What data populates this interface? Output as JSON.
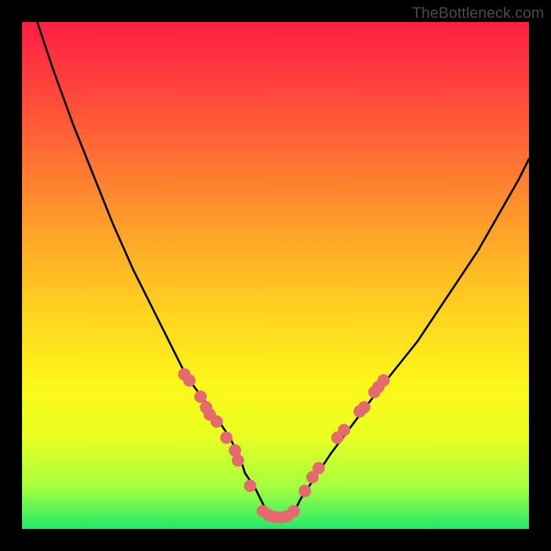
{
  "watermark": "TheBottleneck.com",
  "chart_data": {
    "type": "line",
    "title": "",
    "xlabel": "",
    "ylabel": "",
    "xlim": [
      0,
      100
    ],
    "ylim": [
      0,
      100
    ],
    "grid": false,
    "legend": false,
    "series": [
      {
        "name": "curve",
        "x": [
          3,
          6,
          10,
          14,
          18,
          22,
          26,
          30,
          32,
          34,
          37,
          39,
          41,
          43,
          44,
          46,
          47,
          48,
          49,
          50,
          51,
          52,
          53,
          54,
          55,
          57,
          59,
          61,
          64,
          67,
          70,
          74,
          78,
          82,
          86,
          90,
          94,
          98,
          100
        ],
        "y": [
          100,
          91,
          80,
          70,
          60,
          51,
          43,
          35,
          31,
          28,
          24,
          21,
          18,
          14,
          11,
          8,
          6,
          4,
          3,
          2,
          2,
          2,
          3,
          4,
          6,
          9,
          12,
          15,
          19,
          23,
          27,
          32,
          37,
          43,
          49,
          55,
          62,
          69,
          73
        ]
      }
    ],
    "markers": {
      "name": "dots",
      "color": "#e46a6f",
      "points": [
        {
          "x": 32.0,
          "y": 30.5
        },
        {
          "x": 33.0,
          "y": 29.3
        },
        {
          "x": 35.2,
          "y": 26.1
        },
        {
          "x": 36.3,
          "y": 24.0
        },
        {
          "x": 37.0,
          "y": 22.6
        },
        {
          "x": 38.4,
          "y": 21.2
        },
        {
          "x": 40.3,
          "y": 18.0
        },
        {
          "x": 42.0,
          "y": 15.5
        },
        {
          "x": 42.6,
          "y": 13.5
        },
        {
          "x": 45.0,
          "y": 8.5
        },
        {
          "x": 47.5,
          "y": 3.5
        },
        {
          "x": 48.7,
          "y": 2.7
        },
        {
          "x": 49.9,
          "y": 2.3
        },
        {
          "x": 51.1,
          "y": 2.3
        },
        {
          "x": 52.3,
          "y": 2.5
        },
        {
          "x": 53.6,
          "y": 3.5
        },
        {
          "x": 55.8,
          "y": 7.5
        },
        {
          "x": 57.3,
          "y": 10.2
        },
        {
          "x": 58.5,
          "y": 12.0
        },
        {
          "x": 62.2,
          "y": 18.0
        },
        {
          "x": 63.5,
          "y": 19.5
        },
        {
          "x": 66.6,
          "y": 23.2
        },
        {
          "x": 67.5,
          "y": 24.0
        },
        {
          "x": 69.5,
          "y": 27.0
        },
        {
          "x": 70.3,
          "y": 28.0
        },
        {
          "x": 71.3,
          "y": 29.3
        }
      ]
    }
  }
}
